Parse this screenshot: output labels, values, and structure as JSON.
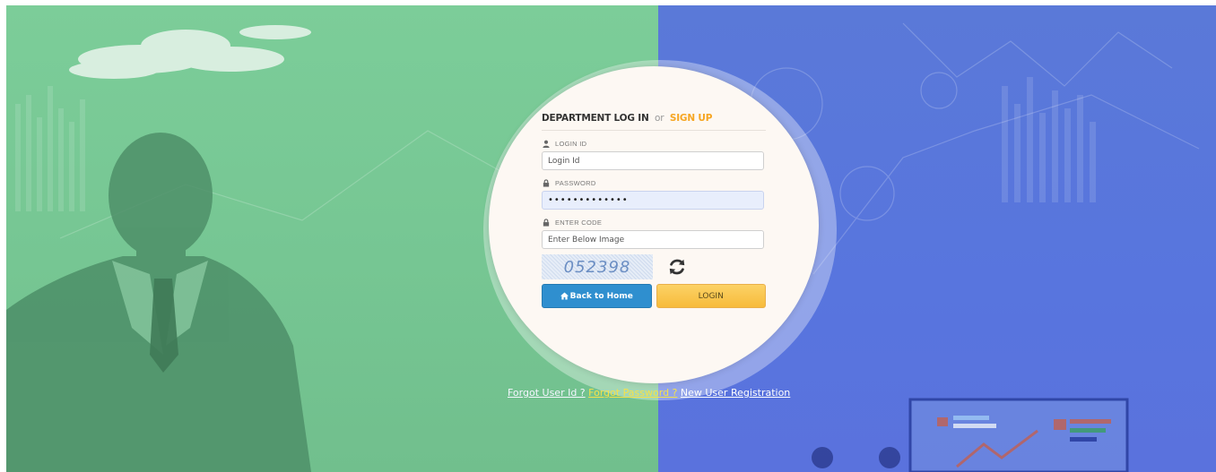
{
  "form": {
    "title": "DEPARTMENT LOG IN",
    "or_text": "or",
    "signup_text": "SIGN UP",
    "login_id_label": "LOGIN ID",
    "login_id_placeholder": "Login Id",
    "password_label": "PASSWORD",
    "password_value": "•••••••••••••",
    "code_label": "ENTER CODE",
    "code_placeholder": "Enter Below Image",
    "captcha_text": "052398",
    "back_home_label": "Back to Home",
    "login_label": "LOGIN"
  },
  "links": {
    "forgot_user_id": "Forgot User Id ?",
    "forgot_password": "Forgot Password ?",
    "new_registration": "New User Registration"
  },
  "icons": {
    "user": "user-icon",
    "lock": "lock-icon",
    "refresh": "refresh-icon",
    "home": "home-icon"
  },
  "colors": {
    "left_bg": "#76c693",
    "right_bg": "#5875de",
    "signup": "#f6a623",
    "home_button": "#2f8fcf",
    "login_button": "#f7bb3b"
  }
}
